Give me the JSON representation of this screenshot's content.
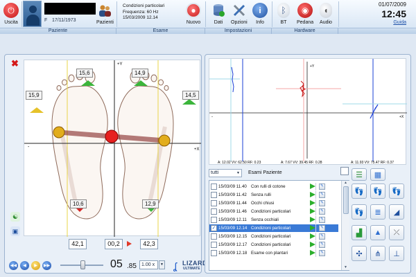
{
  "toolbar": {
    "exit_label": "Uscita",
    "patient_sex": "F",
    "patient_dob": "17/11/1973",
    "patients_label": "Pazienti",
    "exam_info": [
      "Condizioni particolari",
      "Frequenza: 60 Hz",
      "15/03/2009 12.14"
    ],
    "new_label": "Nuovo",
    "data_label": "Dati",
    "options_label": "Opzioni",
    "info_label": "Info",
    "bt_label": "BT",
    "platform_label": "Pedana",
    "audio_label": "Audio",
    "date": "01/07/2009",
    "time": "12:45",
    "guide_label": "Guida",
    "groups": {
      "patient": "Paziente",
      "exam": "Esame",
      "settings": "Impostazioni",
      "hardware": "Hardware"
    }
  },
  "foot_view": {
    "axis_y": "+Y",
    "axis_x": "+X",
    "axis_minus": "-",
    "left_front": "15,6",
    "right_front": "14,9",
    "left_side": "15,9",
    "right_side": "14,5",
    "left_heel": "10,6",
    "right_heel": "12,9",
    "left_total": "42,1",
    "center_value": "00,2",
    "right_total": "42,3"
  },
  "playback": {
    "time_main": "05",
    "time_dec": ".85",
    "speed": "1.00 x",
    "slider_position": 0.52,
    "logo_name": "LIZARD",
    "logo_sub": "ULTIMATE"
  },
  "graphs": {
    "axis_y": "+Y",
    "axis_x": "+X",
    "axis_minus": "-",
    "left_stats": "A: 12.02  VV: 62.50  RF: 0.23",
    "center_stats": "A: 7.67  VV: 39.45  RF: 0.28",
    "right_stats": "A: 11.93  VV: 75.47  RF: 0.37"
  },
  "exam_list": {
    "filter": "tutti",
    "title": "Esami Paziente",
    "rows": [
      {
        "date": "15/03/09 11.40",
        "desc": "Con rulli di cotone",
        "checked": false,
        "selected": false
      },
      {
        "date": "15/03/09 11.42",
        "desc": "Senza rulli",
        "checked": false,
        "selected": false
      },
      {
        "date": "15/03/09 11.44",
        "desc": "Occhi chiusi",
        "checked": false,
        "selected": false
      },
      {
        "date": "15/03/09 11.46",
        "desc": "Condizioni particolari",
        "checked": false,
        "selected": false
      },
      {
        "date": "15/03/09 12.11",
        "desc": "Senza occhiali",
        "checked": false,
        "selected": false
      },
      {
        "date": "15/03/09 12.14",
        "desc": "Condizioni particolari",
        "checked": true,
        "selected": true
      },
      {
        "date": "15/03/09 12.15",
        "desc": "Condizioni particolari",
        "checked": false,
        "selected": false
      },
      {
        "date": "15/03/09 12.17",
        "desc": "Condizioni particolari",
        "checked": false,
        "selected": false
      },
      {
        "date": "15/03/09 12.18",
        "desc": "Esame con plantari",
        "checked": false,
        "selected": false
      }
    ]
  },
  "colors": {
    "accent": "#3a7ad6",
    "exit": "#d42323",
    "up_arrow": "#3bb53b",
    "down_arrow": "#d62525",
    "cop_line": "#1a3fd6"
  }
}
